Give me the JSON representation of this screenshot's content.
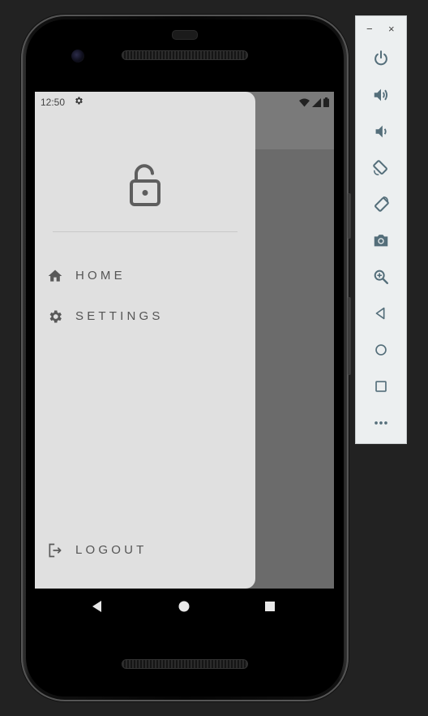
{
  "status_bar": {
    "time": "12:50"
  },
  "drawer": {
    "menu": [
      {
        "label": "HOME",
        "icon": "home-icon"
      },
      {
        "label": "SETTINGS",
        "icon": "gear-icon"
      }
    ],
    "logout_label": "LOGOUT"
  },
  "toolbar": {
    "minimize": "−",
    "close": "×",
    "buttons": [
      "power",
      "volume-up",
      "volume-down",
      "rotate-left",
      "rotate-right",
      "screenshot",
      "zoom",
      "back",
      "home",
      "overview",
      "more"
    ]
  },
  "colors": {
    "drawer_bg": "#e0e0e0",
    "scrim": "#6b6b6b",
    "icon": "#595959",
    "toolbar_icon": "#546e7a"
  }
}
